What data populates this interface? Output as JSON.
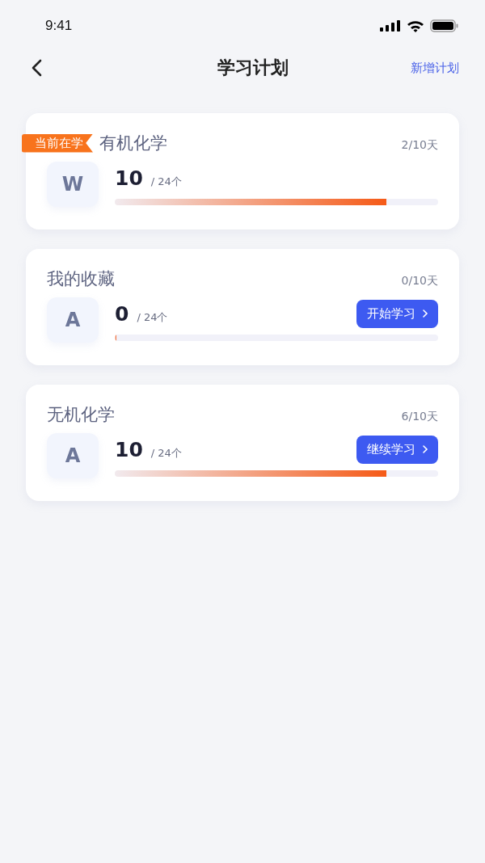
{
  "status_bar": {
    "time": "9:41"
  },
  "nav": {
    "title": "学习计划",
    "action": "新增计划"
  },
  "plans": [
    {
      "tag": "当前在学",
      "title": "有机化学",
      "days": "2/10天",
      "avatar": "W",
      "count": "10",
      "total": "/ 24个",
      "level": 0.84
    },
    {
      "title": "我的收藏",
      "days": "0/10天",
      "avatar": "A",
      "count": "0",
      "total": "/ 24个",
      "level": 0,
      "button": "开始学习"
    },
    {
      "title": "无机化学",
      "days": "6/10天",
      "avatar": "A",
      "count": "10",
      "total": "/ 24个",
      "level": 0.84,
      "button": "继续学习"
    }
  ]
}
